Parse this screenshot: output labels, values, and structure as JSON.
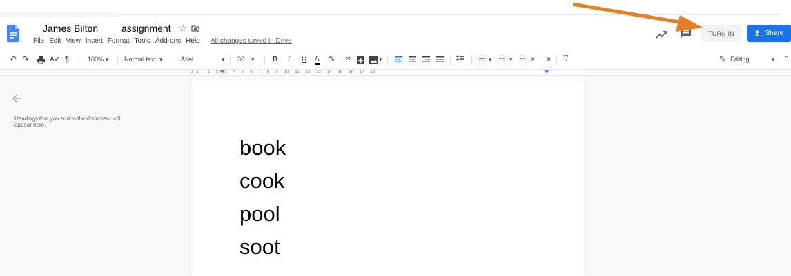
{
  "header": {
    "owner_name": "James Bilton",
    "doc_title": "assignment",
    "star_icon": "star-icon",
    "folder_icon": "folder-icon",
    "menu": [
      "File",
      "Edit",
      "View",
      "Insert",
      "Format",
      "Tools",
      "Add-ons",
      "Help"
    ],
    "save_status": "All changes saved in Drive",
    "turn_in_label": "TURN IN",
    "share_label": "Share"
  },
  "toolbar": {
    "zoom": "100%",
    "style": "Normal text",
    "font": "Arial",
    "font_size": "36",
    "bold": "B",
    "italic": "I",
    "underline": "U",
    "text_color": "A",
    "mode": "Editing"
  },
  "ruler": {
    "ticks": "2 · 1 · · · 1 · · 2 · · 3 · · 4 · · 5 · · 6 · · 7 · · 8 · · 9 · · 10 · · 11 · · 12 · · 13 · · 14 · · 15 · · 16 · · 17 · · 18"
  },
  "outline": {
    "hint": "Headings that you add to the document will appear here."
  },
  "document": {
    "lines": [
      "book",
      "cook",
      "pool",
      "soot"
    ]
  },
  "colors": {
    "accent": "#1a73e8",
    "arrow": "#e67e22",
    "doc_icon": "#4285f4"
  }
}
